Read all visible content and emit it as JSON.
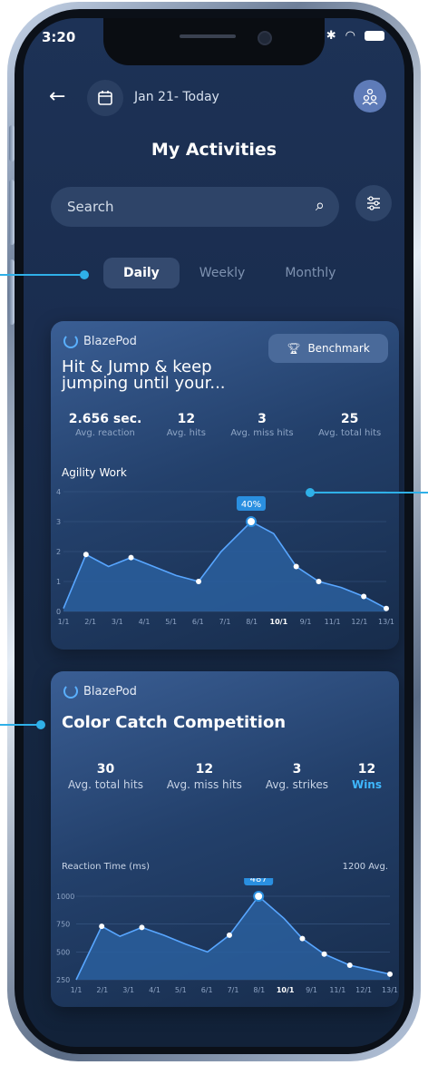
{
  "status_bar": {
    "time": "3:20"
  },
  "header": {
    "date_range": "Jan 21- Today",
    "title": "My Activities"
  },
  "search": {
    "placeholder": "Search"
  },
  "tabs": [
    {
      "label": "Daily"
    },
    {
      "label": "Weekly"
    },
    {
      "label": "Monthly"
    }
  ],
  "card1": {
    "brand": "BlazePod",
    "benchmark_label": "Benchmark",
    "title": "Hit & Jump & keep jumping until your...",
    "stats": [
      {
        "value": "2.656 sec.",
        "label": "Avg. reaction"
      },
      {
        "value": "12",
        "label": "Avg. hits"
      },
      {
        "value": "3",
        "label": "Avg. miss hits"
      },
      {
        "value": "25",
        "label": "Avg. total hits"
      }
    ],
    "section": "Agility Work"
  },
  "card2": {
    "brand": "BlazePod",
    "title": "Color Catch Competition",
    "stats": [
      {
        "value": "30",
        "label": "Avg. total hits"
      },
      {
        "value": "12",
        "label": "Avg. miss hits"
      },
      {
        "value": "3",
        "label": "Avg. strikes"
      },
      {
        "value": "12",
        "label": "Wins"
      }
    ],
    "section": "Reaction Time (ms)",
    "avg_label": "1200 Avg."
  },
  "chart_data": [
    {
      "type": "area",
      "categories": [
        "1/1",
        "2/1",
        "3/1",
        "4/1",
        "5/1",
        "6/1",
        "7/1",
        "8/1",
        "10/1",
        "9/1",
        "11/1",
        "12/1",
        "13/1"
      ],
      "y_ticks": [
        "0",
        "1",
        "2",
        "3",
        "4"
      ],
      "ylim": [
        0,
        4
      ],
      "values": [
        0.1,
        1.9,
        1.5,
        1.8,
        1.5,
        1.2,
        1.0,
        2.0,
        3.0,
        2.6,
        1.5,
        1.0,
        0.8,
        0.5,
        0.1
      ],
      "x_positions": [
        0,
        0.6,
        1.2,
        1.8,
        2.4,
        3.0,
        3.6,
        4.2,
        5.0,
        5.6,
        6.2,
        6.8,
        7.4,
        8.0,
        8.6
      ],
      "markers": [
        1,
        3,
        6,
        8,
        10,
        11,
        13,
        14
      ],
      "highlight_index": 8,
      "highlight_label": "40%",
      "accent": "#2a8fe0"
    },
    {
      "type": "area",
      "categories": [
        "1/1",
        "2/1",
        "3/1",
        "4/1",
        "5/1",
        "6/1",
        "7/1",
        "8/1",
        "10/1",
        "9/1",
        "11/1",
        "12/1",
        "13/1"
      ],
      "y_ticks": [
        "250",
        "500",
        "750",
        "1000"
      ],
      "ylim": [
        250,
        1000
      ],
      "values": [
        250,
        730,
        640,
        720,
        650,
        570,
        500,
        650,
        1000,
        800,
        620,
        480,
        380,
        300
      ],
      "x_positions": [
        0,
        0.7,
        1.2,
        1.8,
        2.4,
        3.0,
        3.6,
        4.2,
        5.0,
        5.7,
        6.2,
        6.8,
        7.5,
        8.6
      ],
      "markers": [
        1,
        3,
        7,
        8,
        10,
        11,
        12,
        13
      ],
      "highlight_index": 8,
      "highlight_label": "487",
      "accent": "#2a8fe0"
    }
  ]
}
